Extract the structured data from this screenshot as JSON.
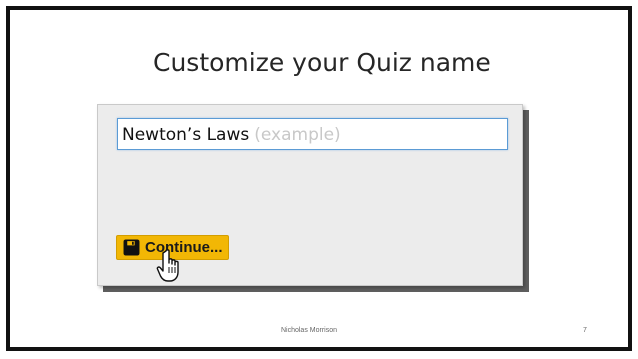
{
  "slide": {
    "title": "Customize your Quiz name",
    "footer_author": "Nicholas Morrison",
    "page_number": "7"
  },
  "quiz_form": {
    "name_value": "Newton’s Laws",
    "name_hint": "(example)",
    "continue_label": "Continue...",
    "button_color": "#f2b705"
  },
  "icons": {
    "button_icon": "save-icon",
    "cursor_icon": "hand-pointer-icon"
  }
}
